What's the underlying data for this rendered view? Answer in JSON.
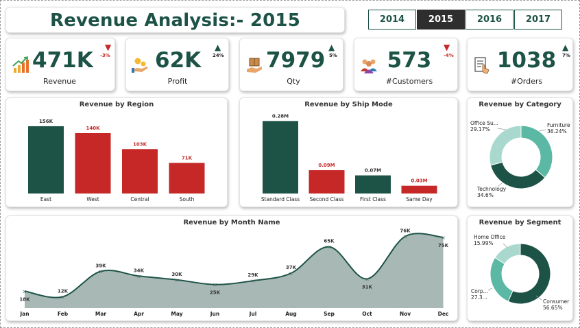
{
  "page_title": "Revenue Analysis:- 2015",
  "years": [
    "2014",
    "2015",
    "2016",
    "2017"
  ],
  "selected_year": "2015",
  "colors": {
    "primary": "#1d5346",
    "accent": "#c62828",
    "teal": "#5bb8a4",
    "light": "#a9d9ce",
    "area": "#a8b9b5"
  },
  "kpis": [
    {
      "value": "471K",
      "label": "Revenue",
      "change": "-3%",
      "direction": "down",
      "icon": "growth-chart-icon"
    },
    {
      "value": "62K",
      "label": "Profit",
      "change": "24%",
      "direction": "up",
      "icon": "money-hand-icon"
    },
    {
      "value": "7979",
      "label": "Qty",
      "change": "5%",
      "direction": "up",
      "icon": "box-hand-icon"
    },
    {
      "value": "573",
      "label": "#Customers",
      "change": "-4%",
      "direction": "down",
      "icon": "people-group-icon"
    },
    {
      "value": "1038",
      "label": "#Orders",
      "change": "7%",
      "direction": "up",
      "icon": "order-list-icon"
    }
  ],
  "chart_data": [
    {
      "title": "Revenue by Region",
      "type": "bar",
      "categories": [
        "East",
        "West",
        "Central",
        "South"
      ],
      "values": [
        156,
        140,
        103,
        71
      ],
      "labels": [
        "156K",
        "140K",
        "103K",
        "71K"
      ],
      "ylim": [
        0,
        175
      ]
    },
    {
      "title": "Revenue by Ship Mode",
      "type": "bar",
      "categories": [
        "Standard Class",
        "Second Class",
        "First Class",
        "Same Day"
      ],
      "values": [
        0.28,
        0.09,
        0.07,
        0.03
      ],
      "labels": [
        "0.28M",
        "0.09M",
        "0.07M",
        "0.03M"
      ],
      "ylim": [
        0,
        0.31
      ]
    },
    {
      "title": "Revenue by Category",
      "type": "pie",
      "slices": [
        {
          "name": "Furniture",
          "label": "36.24%",
          "value": 36.24
        },
        {
          "name": "Technology",
          "label": "34.6%",
          "value": 34.6
        },
        {
          "name": "Office Su...",
          "label": "29.17%",
          "value": 29.17
        }
      ]
    },
    {
      "title": "Revenue by Month Name",
      "type": "area",
      "x": [
        "Jan",
        "Feb",
        "Mar",
        "Apr",
        "May",
        "Jun",
        "Jul",
        "Aug",
        "Sep",
        "Oct",
        "Nov",
        "Dec"
      ],
      "values": [
        18,
        12,
        39,
        34,
        30,
        25,
        29,
        37,
        65,
        31,
        76,
        75
      ],
      "labels": [
        "18K",
        "12K",
        "39K",
        "34K",
        "30K",
        "25K",
        "29K",
        "37K",
        "65K",
        "31K",
        "76K",
        "75K"
      ],
      "ylim": [
        0,
        80
      ]
    },
    {
      "title": "Revenue by Segment",
      "type": "pie",
      "slices": [
        {
          "name": "Consumer",
          "label": "56.65%",
          "value": 56.65
        },
        {
          "name": "Corp...",
          "label": "27.3...",
          "value": 27.36
        },
        {
          "name": "Home Office",
          "label": "15.99%",
          "value": 15.99
        }
      ]
    }
  ]
}
